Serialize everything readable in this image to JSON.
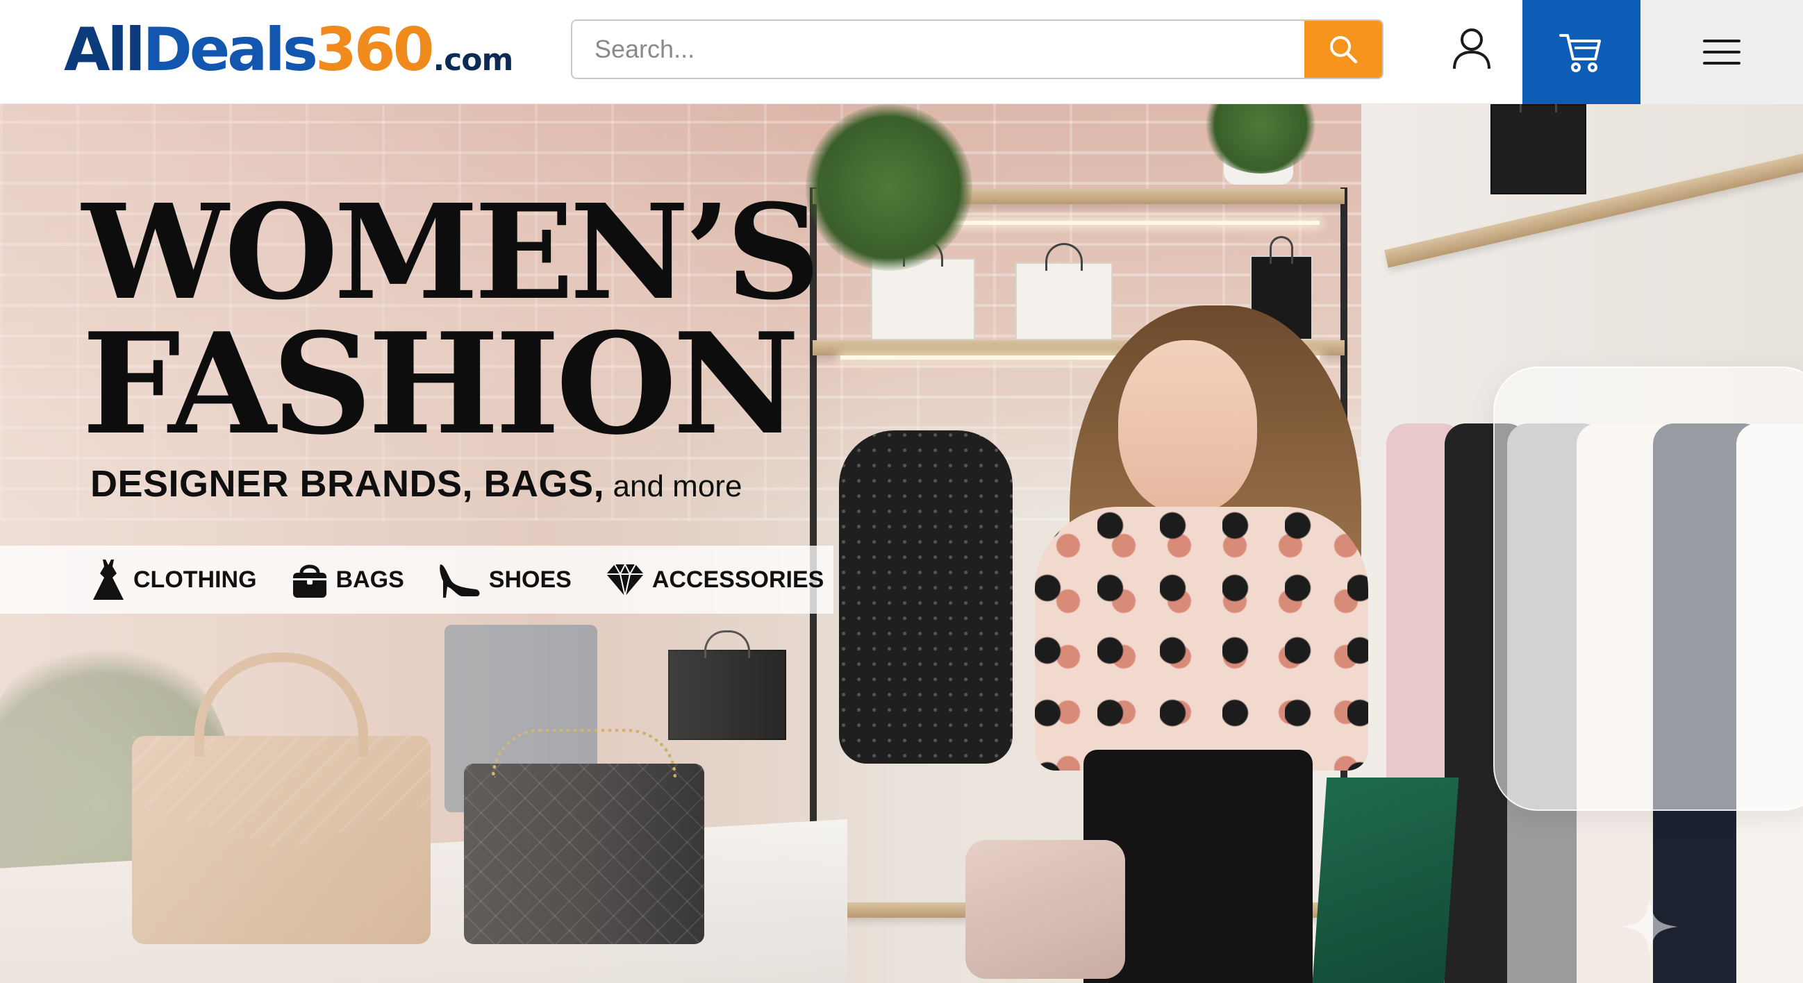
{
  "header": {
    "logo": {
      "part1": "All",
      "part2": "Deals",
      "part3": "360",
      "part4": ".com"
    },
    "search": {
      "placeholder": "Search...",
      "value": ""
    },
    "icons": [
      "search-icon",
      "user-icon",
      "cart-icon",
      "hamburger-menu-icon"
    ]
  },
  "hero": {
    "headline_line1": "WOMEN’S",
    "headline_line2": "FASHION",
    "subheadline_bold": "DESIGNER BRANDS, BAGS,",
    "subheadline_light": "and more",
    "categories": [
      {
        "label": "CLOTHING",
        "icon": "dress-icon"
      },
      {
        "label": "BAGS",
        "icon": "handbag-icon"
      },
      {
        "label": "SHOES",
        "icon": "high-heel-icon"
      },
      {
        "label": "ACCESSORIES",
        "icon": "diamond-icon"
      }
    ]
  },
  "colors": {
    "brand_navy": "#0b3b7a",
    "brand_blue": "#1256b0",
    "brand_orange": "#f08a1c",
    "search_button": "#f7941d",
    "cart_button": "#0d5cb6",
    "menu_button_bg": "#efefef"
  }
}
